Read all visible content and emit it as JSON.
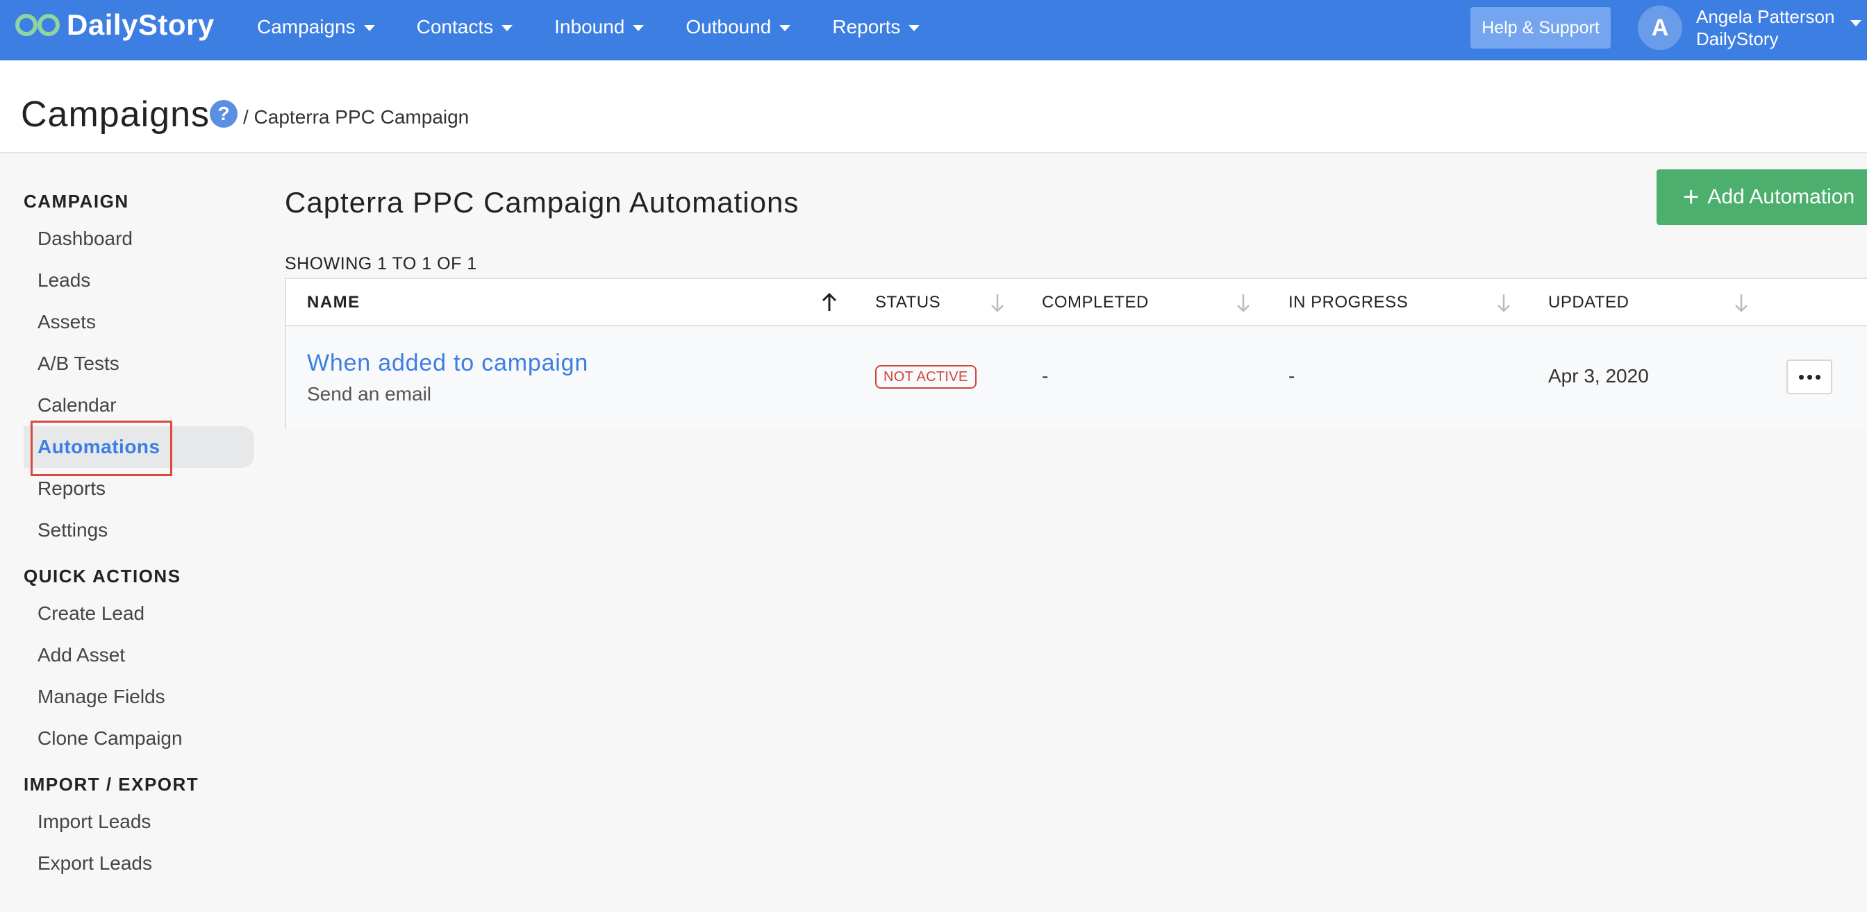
{
  "navbar": {
    "brand": "DailyStory",
    "menu": [
      "Campaigns",
      "Contacts",
      "Inbound",
      "Outbound",
      "Reports"
    ],
    "help_label": "Help & Support",
    "avatar_letter": "A",
    "user_name": "Angela Patterson",
    "user_org": "DailyStory",
    "brand_color": "#3d7ee2"
  },
  "header": {
    "title": "Campaigns",
    "help_glyph": "?",
    "breadcrumb": "/ Capterra PPC Campaign"
  },
  "sidebar": {
    "sections": [
      {
        "heading": "CAMPAIGN",
        "items": [
          "Dashboard",
          "Leads",
          "Assets",
          "A/B Tests",
          "Calendar",
          "Automations",
          "Reports",
          "Settings"
        ]
      },
      {
        "heading": "QUICK ACTIONS",
        "items": [
          "Create Lead",
          "Add Asset",
          "Manage Fields",
          "Clone Campaign"
        ]
      },
      {
        "heading": "IMPORT / EXPORT",
        "items": [
          "Import Leads",
          "Export Leads"
        ]
      }
    ],
    "active_item": "Automations"
  },
  "main": {
    "title": "Capterra PPC Campaign Automations",
    "add_button": "Add Automation",
    "showing": "SHOWING 1 TO 1 OF 1",
    "columns": [
      "NAME",
      "STATUS",
      "COMPLETED",
      "IN PROGRESS",
      "UPDATED"
    ],
    "rows": [
      {
        "name": "When added to campaign",
        "description": "Send an email",
        "status": "NOT ACTIVE",
        "completed": "-",
        "in_progress": "-",
        "updated": "Apr 3, 2020"
      }
    ]
  }
}
